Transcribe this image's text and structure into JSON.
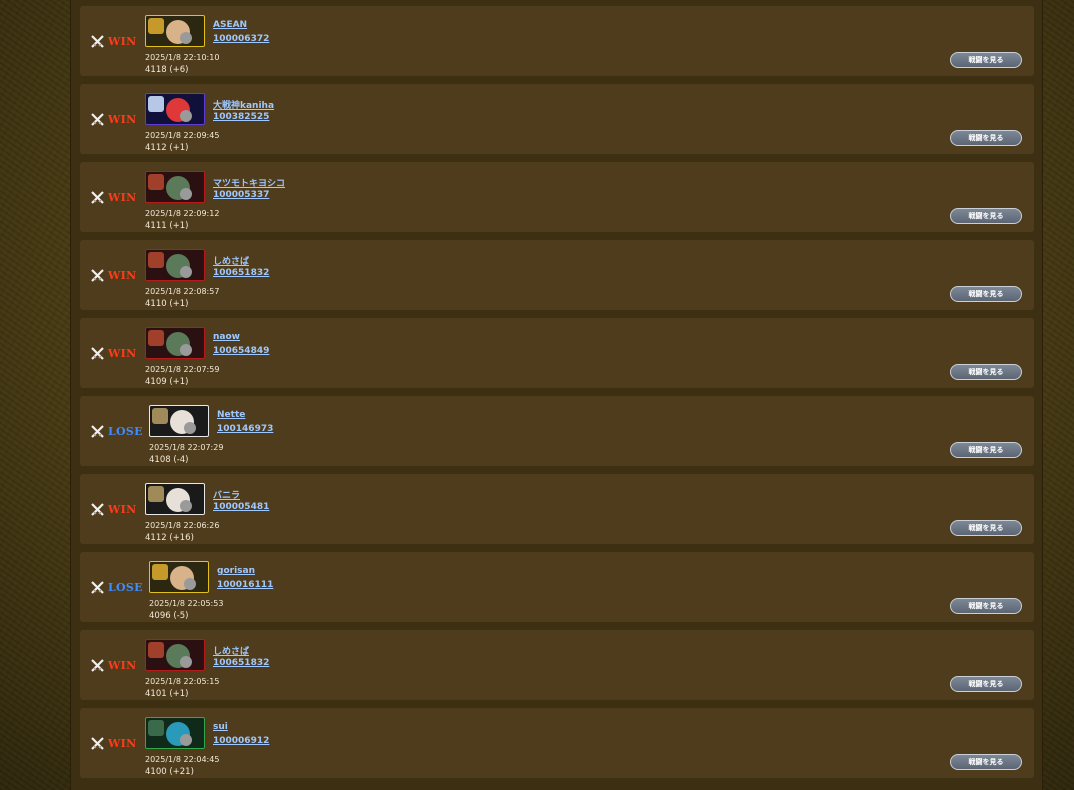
{
  "view_button_label": "戦闘を見る",
  "colors": {
    "win": "#ff3a1a",
    "lose": "#3f8cff",
    "link": "#9ec8ff"
  },
  "battles": [
    {
      "result": "WIN",
      "name": "ASEAN",
      "id": "100006372",
      "datetime": "2025/1/8 22:10:10",
      "rating": "4118 (+6)",
      "frame": "gold"
    },
    {
      "result": "WIN",
      "name": "大戦神kaniha",
      "id": "100382525",
      "datetime": "2025/1/8 22:09:45",
      "rating": "4112 (+1)",
      "frame": "blue"
    },
    {
      "result": "WIN",
      "name": "マツモトキヨシコ",
      "id": "100005337",
      "datetime": "2025/1/8 22:09:12",
      "rating": "4111 (+1)",
      "frame": "red"
    },
    {
      "result": "WIN",
      "name": "しめさば",
      "id": "100651832",
      "datetime": "2025/1/8 22:08:57",
      "rating": "4110 (+1)",
      "frame": "red"
    },
    {
      "result": "WIN",
      "name": "naow",
      "id": "100654849",
      "datetime": "2025/1/8 22:07:59",
      "rating": "4109 (+1)",
      "frame": "red"
    },
    {
      "result": "LOSE",
      "name": "Nette",
      "id": "100146973",
      "datetime": "2025/1/8 22:07:29",
      "rating": "4108 (-4)",
      "frame": "white"
    },
    {
      "result": "WIN",
      "name": "バニラ",
      "id": "100005481",
      "datetime": "2025/1/8 22:06:26",
      "rating": "4112 (+16)",
      "frame": "white"
    },
    {
      "result": "LOSE",
      "name": "gorisan",
      "id": "100016111",
      "datetime": "2025/1/8 22:05:53",
      "rating": "4096 (-5)",
      "frame": "gold"
    },
    {
      "result": "WIN",
      "name": "しめさば",
      "id": "100651832",
      "datetime": "2025/1/8 22:05:15",
      "rating": "4101 (+1)",
      "frame": "red"
    },
    {
      "result": "WIN",
      "name": "sui",
      "id": "100006912",
      "datetime": "2025/1/8 22:04:45",
      "rating": "4100 (+21)",
      "frame": "green"
    }
  ]
}
